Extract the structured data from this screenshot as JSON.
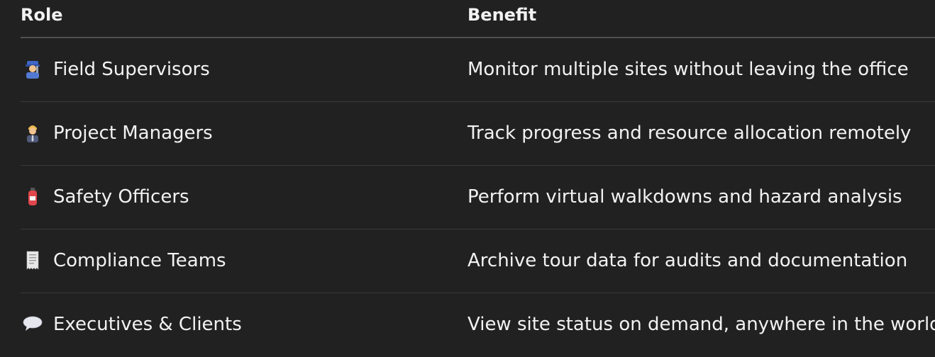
{
  "table": {
    "headers": {
      "role": "Role",
      "benefit": "Benefit"
    },
    "rows": [
      {
        "icon": "technician-emoji-icon",
        "role": "Field Supervisors",
        "benefit": "Monitor multiple sites without leaving the office"
      },
      {
        "icon": "office-worker-emoji-icon",
        "role": "Project Managers",
        "benefit": "Track progress and resource allocation remotely"
      },
      {
        "icon": "fire-extinguisher-emoji-icon",
        "role": "Safety Officers",
        "benefit": "Perform virtual walkdowns and hazard analysis"
      },
      {
        "icon": "receipt-emoji-icon",
        "role": "Compliance Teams",
        "benefit": "Archive tour data for audits and documentation"
      },
      {
        "icon": "speech-bubble-emoji-icon",
        "role": "Executives & Clients",
        "benefit": "View site status on demand, anywhere in the world"
      }
    ]
  }
}
